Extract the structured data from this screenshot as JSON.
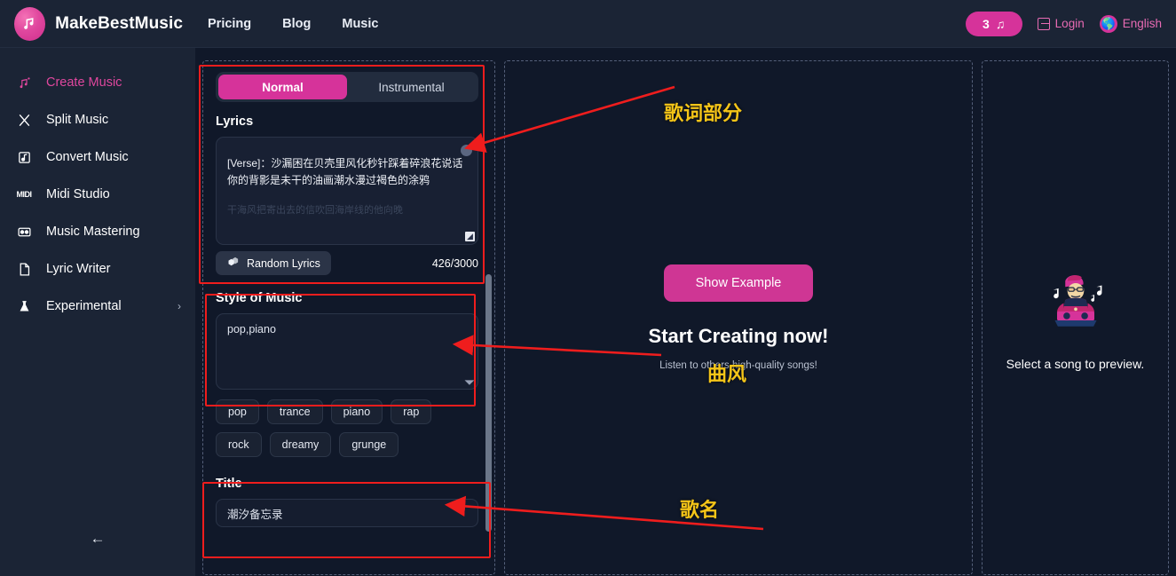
{
  "header": {
    "brand_name": "MakeBestMusic",
    "logo_icon": "music-note-logo-icon",
    "nav": [
      {
        "label": "Pricing"
      },
      {
        "label": "Blog"
      },
      {
        "label": "Music"
      }
    ],
    "credits": "3",
    "credits_icon": "music-note-icon",
    "login_label": "Login",
    "login_icon": "login-icon",
    "language_label": "English",
    "language_icon": "globe-icon"
  },
  "sidebar": {
    "items": [
      {
        "label": "Create Music",
        "icon": "music-notes-icon",
        "active": true
      },
      {
        "label": "Split Music",
        "icon": "split-icon",
        "active": false
      },
      {
        "label": "Convert Music",
        "icon": "convert-icon",
        "active": false
      },
      {
        "label": "Midi Studio",
        "icon": "midi-icon",
        "active": false
      },
      {
        "label": "Music Mastering",
        "icon": "mastering-icon",
        "active": false
      },
      {
        "label": "Lyric Writer",
        "icon": "document-icon",
        "active": false
      },
      {
        "label": "Experimental",
        "icon": "flask-icon",
        "active": false,
        "chevron": "›"
      }
    ],
    "collapse_icon": "←"
  },
  "create_panel": {
    "mode_tabs": [
      {
        "label": "Normal",
        "selected": true
      },
      {
        "label": "Instrumental",
        "selected": false
      }
    ],
    "lyrics": {
      "label": "Lyrics",
      "value": "[Verse]：沙漏困在贝壳里风化秒针踩着碎浪花说话你的背影是未干的油画潮水漫过褐色的涂鸦",
      "value_faded": "干海风把寄出去的信吹回海岸线的他向晚",
      "random_button": "Random Lyrics",
      "random_icon": "dice-icon",
      "counter": "426/3000"
    },
    "style": {
      "label": "Style of Music",
      "value": "pop,piano",
      "tags": [
        "pop",
        "trance",
        "piano",
        "rap",
        "rock",
        "dreamy",
        "grunge"
      ]
    },
    "title": {
      "label": "Title",
      "value": "潮汐备忘录"
    }
  },
  "center_panel": {
    "show_example_button": "Show Example",
    "heading": "Start Creating now!",
    "subtext": "Listen to others high-quality songs!"
  },
  "right_panel": {
    "illustration": "dj-character-icon",
    "empty_text": "Select a song to preview."
  },
  "annotations": {
    "lyrics_note": "歌词部分",
    "style_note": "曲风",
    "title_note": "歌名",
    "box_color": "#ef1d1d",
    "note_color": "#f5c518"
  }
}
